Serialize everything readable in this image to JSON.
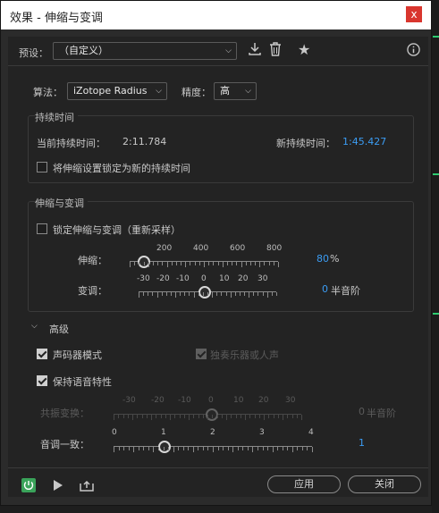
{
  "window": {
    "title": "效果 - 伸缩与变调",
    "close": "x"
  },
  "preset": {
    "label": "预设：",
    "value": "（自定义）"
  },
  "algorithm": {
    "label": "算法：",
    "value": "iZotope Radius"
  },
  "precision": {
    "label": "精度：",
    "value": "高"
  },
  "duration": {
    "header": "持续时间",
    "current_label": "当前持续时间：",
    "current_value": "2:11.784",
    "new_label": "新持续时间：",
    "new_value": "1:45.427",
    "lock_label": "将伸缩设置锁定为新的持续时间",
    "lock_checked": false
  },
  "stretch_pitch": {
    "header": "伸缩与变调",
    "lock_label": "锁定伸缩与变调（重新采样）",
    "lock_checked": false,
    "stretch": {
      "label": "伸缩：",
      "ticks": [
        "200",
        "400",
        "600",
        "800"
      ],
      "value": "80",
      "unit": "%"
    },
    "pitch": {
      "label": "变调：",
      "ticks": [
        "-30",
        "-20",
        "-10",
        "0",
        "10",
        "20",
        "30"
      ],
      "value": "0",
      "unit": "半音阶"
    }
  },
  "advanced": {
    "header": "高级",
    "vocoder_label": "声码器模式",
    "vocoder_checked": true,
    "solo_label": "独奏乐器或人声",
    "solo_checked": true,
    "preserve_label": "保持语音特性",
    "preserve_checked": true,
    "formant": {
      "label": "共振变换：",
      "ticks": [
        "-30",
        "-20",
        "-10",
        "0",
        "10",
        "20",
        "30"
      ],
      "value": "0",
      "unit": "半音阶"
    },
    "pitch_coherence": {
      "label": "音调一致：",
      "ticks": [
        "0",
        "1",
        "2",
        "3",
        "4"
      ],
      "value": "1"
    }
  },
  "buttons": {
    "apply": "应用",
    "close": "关闭"
  },
  "colors": {
    "accent": "#3b9cf3",
    "power": "#3aa35a",
    "close_button": "#d9362e"
  },
  "icons": [
    "chevron-down-icon",
    "download-icon",
    "trash-icon",
    "star-icon",
    "info-icon",
    "power-icon",
    "play-icon",
    "export-icon"
  ]
}
